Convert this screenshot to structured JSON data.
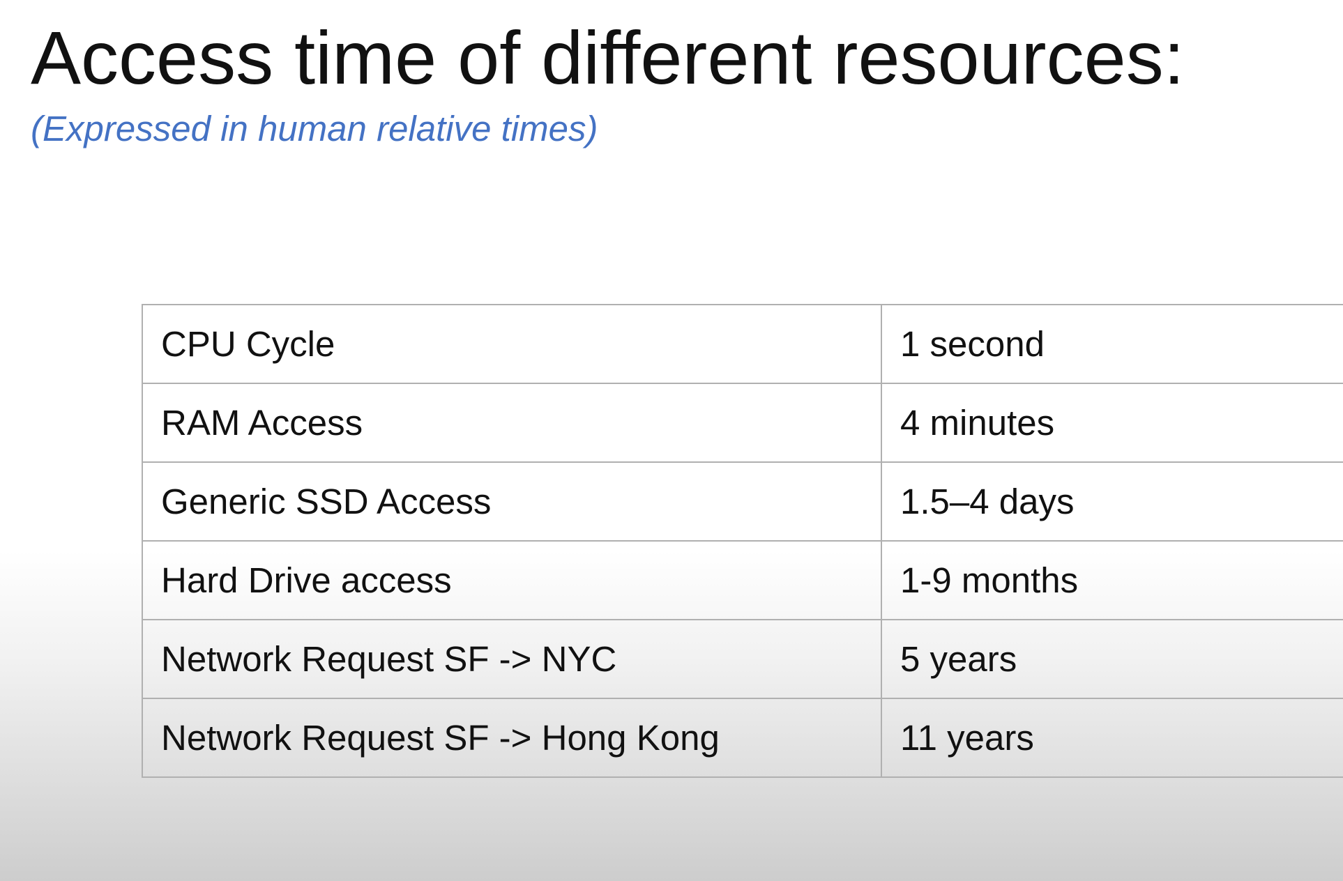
{
  "slide": {
    "title": "Access time of different resources:",
    "subtitle": "(Expressed in human relative times)"
  },
  "table": {
    "rows": [
      {
        "resource": "CPU Cycle",
        "time": "1 second"
      },
      {
        "resource": "RAM Access",
        "time": "4 minutes"
      },
      {
        "resource": "Generic SSD Access",
        "time": "1.5–4 days"
      },
      {
        "resource": "Hard Drive access",
        "time": "1-9 months"
      },
      {
        "resource": "Network Request SF -> NYC",
        "time": "5 years"
      },
      {
        "resource": "Network Request SF -> Hong Kong",
        "time": "11 years"
      }
    ]
  },
  "colors": {
    "title": "#111111",
    "subtitle": "#4472c4",
    "table_border": "#b0b0b0"
  }
}
